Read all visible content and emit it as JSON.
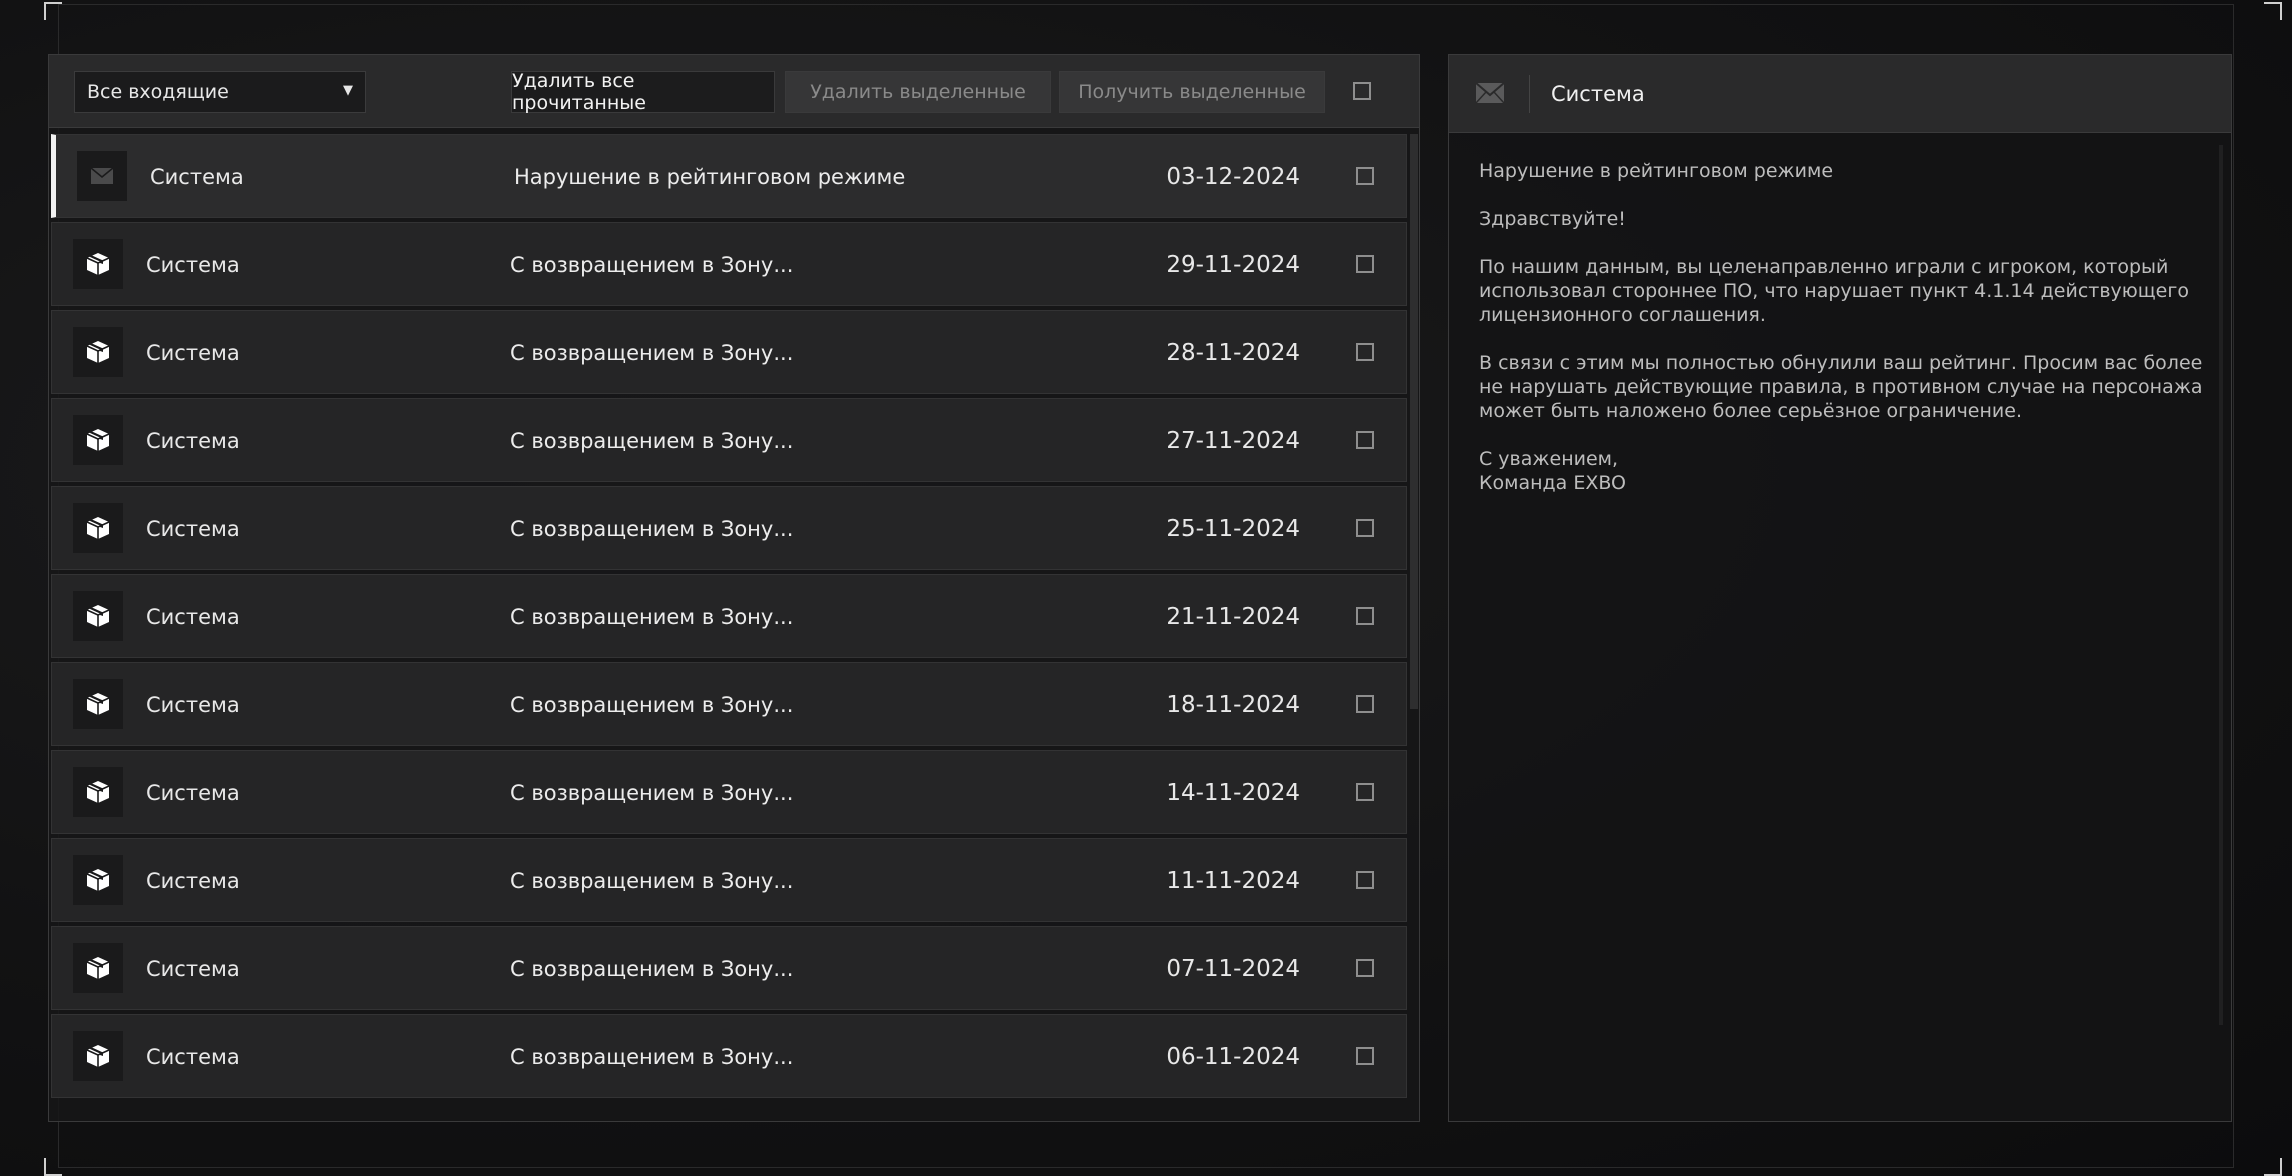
{
  "toolbar": {
    "filter_selected": "Все входящие",
    "delete_read_label": "Удалить все прочитанные",
    "delete_selected_label": "Удалить выделенные",
    "receive_selected_label": "Получить выделенные"
  },
  "messages": [
    {
      "sender": "Система",
      "subject": "Нарушение в рейтинговом режиме",
      "date": "03-12-2024",
      "icon": "envelope-icon"
    },
    {
      "sender": "Система",
      "subject": "С возвращением в Зону...",
      "date": "29-11-2024",
      "icon": "package-icon"
    },
    {
      "sender": "Система",
      "subject": "С возвращением в Зону...",
      "date": "28-11-2024",
      "icon": "package-icon"
    },
    {
      "sender": "Система",
      "subject": "С возвращением в Зону...",
      "date": "27-11-2024",
      "icon": "package-icon"
    },
    {
      "sender": "Система",
      "subject": "С возвращением в Зону...",
      "date": "25-11-2024",
      "icon": "package-icon"
    },
    {
      "sender": "Система",
      "subject": "С возвращением в Зону...",
      "date": "21-11-2024",
      "icon": "package-icon"
    },
    {
      "sender": "Система",
      "subject": "С возвращением в Зону...",
      "date": "18-11-2024",
      "icon": "package-icon"
    },
    {
      "sender": "Система",
      "subject": "С возвращением в Зону...",
      "date": "14-11-2024",
      "icon": "package-icon"
    },
    {
      "sender": "Система",
      "subject": "С возвращением в Зону...",
      "date": "11-11-2024",
      "icon": "package-icon"
    },
    {
      "sender": "Система",
      "subject": "С возвращением в Зону...",
      "date": "07-11-2024",
      "icon": "package-icon"
    },
    {
      "sender": "Система",
      "subject": "С возвращением в Зону...",
      "date": "06-11-2024",
      "icon": "package-icon"
    }
  ],
  "reader": {
    "sender": "Система",
    "paragraphs": [
      "Нарушение в рейтинговом режиме",
      "Здравствуйте!",
      "По нашим данным, вы целенаправленно играли с игроком, который\nиспользовал стороннее ПО, что нарушает пункт 4.1.14 действующего\nлицензионного соглашения.",
      "В связи с этим мы полностью обнулили ваш рейтинг. Просим вас более\nне нарушать действующие правила, в противном случае на персонажа\nможет быть наложено более серьёзное ограничение.",
      "С уважением,\nКоманда EXBO"
    ]
  }
}
